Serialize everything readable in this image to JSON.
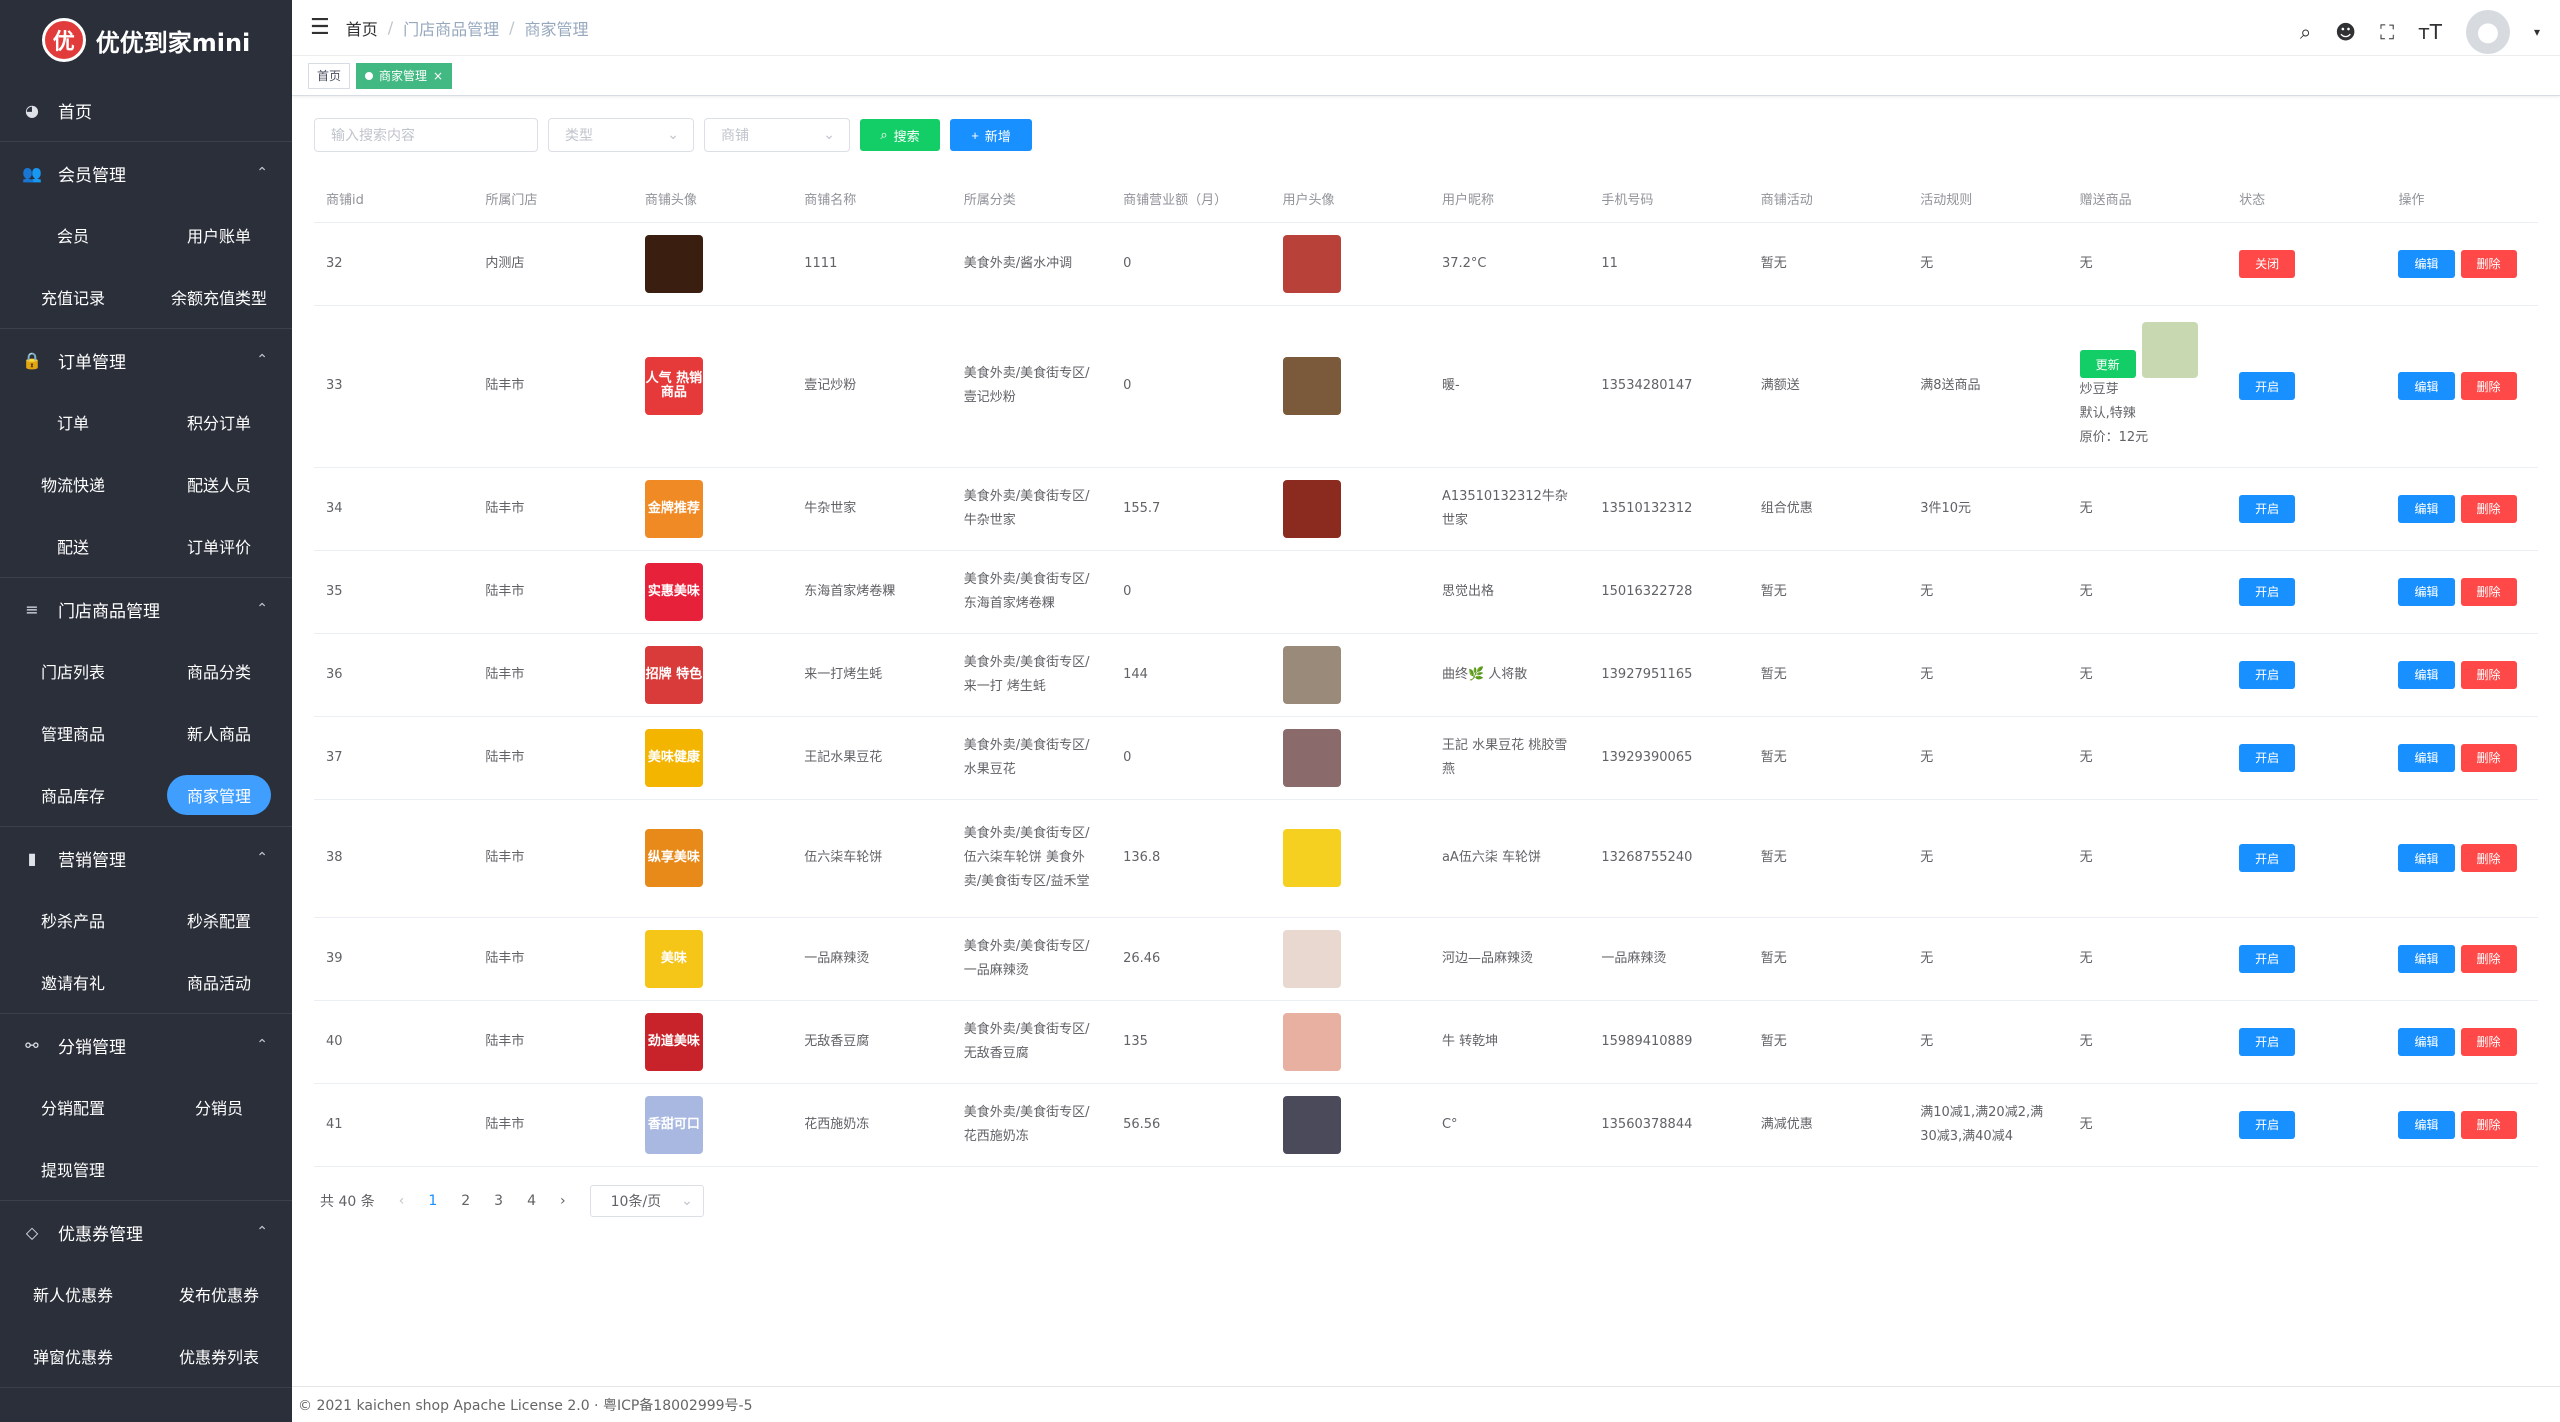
{
  "app": {
    "brand": "优优到家mini",
    "logo_glyph": "优"
  },
  "sidebar": {
    "home": "首页",
    "groups": [
      {
        "title": "会员管理",
        "icon": "users-icon",
        "items": [
          "会员",
          "用户账单",
          "充值记录",
          "余额充值类型"
        ]
      },
      {
        "title": "订单管理",
        "icon": "lock-icon",
        "items": [
          "订单",
          "积分订单",
          "物流快递",
          "配送人员",
          "配送",
          "订单评价"
        ]
      },
      {
        "title": "门店商品管理",
        "icon": "list-icon",
        "items": [
          "门店列表",
          "商品分类",
          "管理商品",
          "新人商品",
          "商品库存",
          "商家管理"
        ]
      },
      {
        "title": "营销管理",
        "icon": "chart-icon",
        "items": [
          "秒杀产品",
          "秒杀配置",
          "邀请有礼",
          "商品活动"
        ]
      },
      {
        "title": "分销管理",
        "icon": "share-icon",
        "items": [
          "分销配置",
          "分销员",
          "提现管理"
        ]
      },
      {
        "title": "优惠券管理",
        "icon": "tag-icon",
        "items": [
          "新人优惠券",
          "发布优惠券",
          "弹窗优惠券",
          "优惠券列表"
        ]
      }
    ],
    "active_item": "商家管理"
  },
  "navbar": {
    "breadcrumb": [
      "首页",
      "门店商品管理",
      "商家管理"
    ]
  },
  "tags": {
    "home": "首页",
    "active": "商家管理",
    "close": "×"
  },
  "toolbar": {
    "search_placeholder": "输入搜索内容",
    "type_placeholder": "类型",
    "shop_placeholder": "商铺",
    "search_btn": "搜索",
    "add_btn": "新增"
  },
  "table": {
    "headers": [
      "商铺id",
      "所属门店",
      "商铺头像",
      "商铺名称",
      "所属分类",
      "商铺营业额（月）",
      "用户头像",
      "用户昵称",
      "手机号码",
      "商铺活动",
      "活动规则",
      "赠送商品",
      "状态",
      "操作"
    ],
    "edit_label": "编辑",
    "delete_label": "删除",
    "rows": [
      {
        "id": "32",
        "store": "内测店",
        "name": "1111",
        "category": "美食外卖/酱水冲调",
        "revenue": "0",
        "nickname": "37.2°C",
        "phone": "11",
        "activity": "暂无",
        "rule": "无",
        "gift": "无",
        "status": "关闭",
        "thumb_text": "",
        "thumb_color": "#3a1f10",
        "avatar_color": "#b8423a"
      },
      {
        "id": "33",
        "store": "陆丰市",
        "name": "壹记炒粉",
        "category": "美食外卖/美食街专区/壹记炒粉",
        "revenue": "0",
        "nickname": "暖-",
        "phone": "13534280147",
        "activity": "满额送",
        "rule": "满8送商品",
        "gift": "",
        "status": "开启",
        "thumb_text": "人气 热销商品",
        "thumb_color": "#e63a3a",
        "avatar_color": "#7a5a3a"
      },
      {
        "id": "34",
        "store": "陆丰市",
        "name": "牛杂世家",
        "category": "美食外卖/美食街专区/牛杂世家",
        "revenue": "155.7",
        "nickname": "A13510132312牛杂世家",
        "phone": "13510132312",
        "activity": "组合优惠",
        "rule": "3件10元",
        "gift": "无",
        "status": "开启",
        "thumb_text": "金牌推荐",
        "thumb_color": "#f08a24",
        "avatar_color": "#8b2a1e"
      },
      {
        "id": "35",
        "store": "陆丰市",
        "name": "东海首家烤卷粿",
        "category": "美食外卖/美食街专区/东海首家烤卷粿",
        "revenue": "0",
        "nickname": "思觉出格",
        "phone": "15016322728",
        "activity": "暂无",
        "rule": "无",
        "gift": "无",
        "status": "开启",
        "thumb_text": "实惠美味",
        "thumb_color": "#e8213a",
        "avatar_color": ""
      },
      {
        "id": "36",
        "store": "陆丰市",
        "name": "来一打烤生蚝",
        "category": "美食外卖/美食街专区/来一打 烤生蚝",
        "revenue": "144",
        "nickname": "曲终🌿 人将散",
        "phone": "13927951165",
        "activity": "暂无",
        "rule": "无",
        "gift": "无",
        "status": "开启",
        "thumb_text": "招牌 特色",
        "thumb_color": "#d93a3a",
        "avatar_color": "#9a8a7a"
      },
      {
        "id": "37",
        "store": "陆丰市",
        "name": "王記水果豆花",
        "category": "美食外卖/美食街专区/水果豆花",
        "revenue": "0",
        "nickname": "王記 水果豆花 桃胶雪燕",
        "phone": "13929390065",
        "activity": "暂无",
        "rule": "无",
        "gift": "无",
        "status": "开启",
        "thumb_text": "美味健康",
        "thumb_color": "#f3b500",
        "avatar_color": "#8a6a6a"
      },
      {
        "id": "38",
        "store": "陆丰市",
        "name": "伍六柒车轮饼",
        "category": "美食外卖/美食街专区/伍六柒车轮饼 美食外卖/美食街专区/益禾堂",
        "revenue": "136.8",
        "nickname": "aA伍六柒 车轮饼",
        "phone": "13268755240",
        "activity": "暂无",
        "rule": "无",
        "gift": "无",
        "status": "开启",
        "thumb_text": "纵享美味",
        "thumb_color": "#e88a1a",
        "avatar_color": "#f5d020"
      },
      {
        "id": "39",
        "store": "陆丰市",
        "name": "一品麻辣烫",
        "category": "美食外卖/美食街专区/一品麻辣烫",
        "revenue": "26.46",
        "nickname": "河边—品麻辣烫",
        "phone": "一品麻辣烫",
        "activity": "暂无",
        "rule": "无",
        "gift": "无",
        "status": "开启",
        "thumb_text": "美味",
        "thumb_color": "#f5c518",
        "avatar_color": "#e8d8d0"
      },
      {
        "id": "40",
        "store": "陆丰市",
        "name": "无敌香豆腐",
        "category": "美食外卖/美食街专区/无敌香豆腐",
        "revenue": "135",
        "nickname": "牛 转乾坤",
        "phone": "15989410889",
        "activity": "暂无",
        "rule": "无",
        "gift": "无",
        "status": "开启",
        "thumb_text": "劲道美味",
        "thumb_color": "#c8222a",
        "avatar_color": "#e8b0a0"
      },
      {
        "id": "41",
        "store": "陆丰市",
        "name": "花西施奶冻",
        "category": "美食外卖/美食街专区/花西施奶冻",
        "revenue": "56.56",
        "nickname": "C°",
        "phone": "13560378844",
        "activity": "满减优惠",
        "rule": "满10减1,满20减2,满30减3,满40减4",
        "gift": "无",
        "status": "开启",
        "thumb_text": "香甜可口",
        "thumb_color": "#a8b8e0",
        "avatar_color": "#4a4a5a"
      }
    ],
    "gift_row33": {
      "update": "更新",
      "name": "炒豆芽",
      "spec": "默认,特辣",
      "price": "原价：12元"
    }
  },
  "pager": {
    "total": "共 40 条",
    "pages": [
      "1",
      "2",
      "3",
      "4"
    ],
    "size": "10条/页",
    "prev": "‹",
    "next": "›"
  },
  "footer": "© 2021 kaichen shop Apache License 2.0 · 粤ICP备18002999号-5",
  "colors": {
    "sidebar": "#2b2f3a",
    "primary": "#1890ff",
    "danger": "#ff4949",
    "success": "#13ce66",
    "tag": "#42b983"
  }
}
